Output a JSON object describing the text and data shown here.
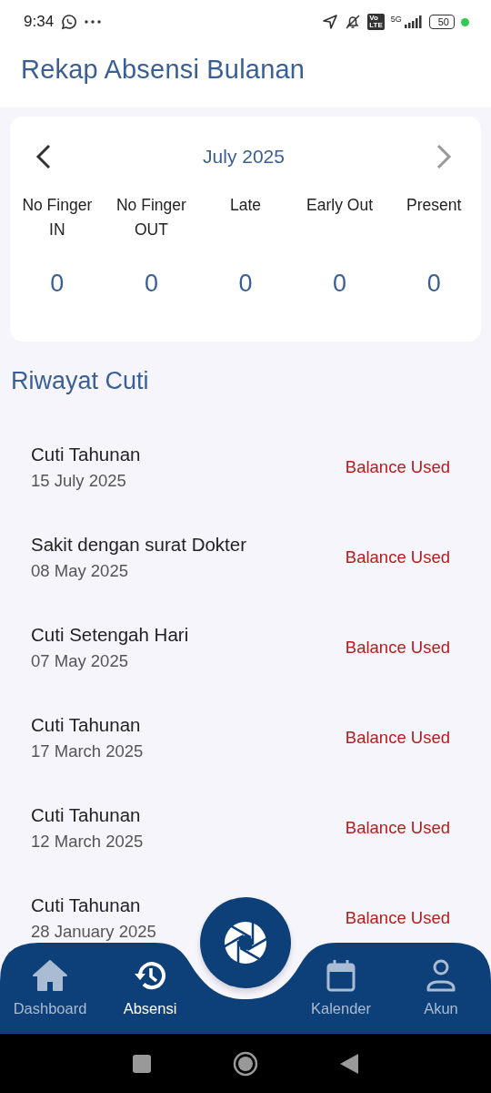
{
  "status_bar": {
    "time": "9:34",
    "volte": [
      "Vo",
      "LTE"
    ],
    "network": "5G",
    "battery": "50"
  },
  "header": {
    "title": "Rekap Absensi Bulanan"
  },
  "summary": {
    "month": "July 2025",
    "prev": {
      "disabled": false
    },
    "next": {
      "disabled": true
    },
    "columns": [
      {
        "label": "No Finger IN",
        "value": "0"
      },
      {
        "label": "No Finger OUT",
        "value": "0"
      },
      {
        "label": "Late",
        "value": "0"
      },
      {
        "label": "Early Out",
        "value": "0"
      },
      {
        "label": "Present",
        "value": "0"
      }
    ]
  },
  "leave_history": {
    "title": "Riwayat Cuti",
    "items": [
      {
        "type": "Cuti Tahunan",
        "date": "15 July 2025",
        "status": "Balance Used"
      },
      {
        "type": "Sakit dengan surat Dokter",
        "date": "08 May 2025",
        "status": "Balance Used"
      },
      {
        "type": "Cuti Setengah Hari",
        "date": "07 May 2025",
        "status": "Balance Used"
      },
      {
        "type": "Cuti Tahunan",
        "date": "17 March 2025",
        "status": "Balance Used"
      },
      {
        "type": "Cuti Tahunan",
        "date": "12 March 2025",
        "status": "Balance Used"
      },
      {
        "type": "Cuti Tahunan",
        "date": "28 January 2025",
        "status": "Balance Used"
      }
    ]
  },
  "bottom_nav": {
    "items": [
      {
        "kind": "home",
        "label": "Dashboard",
        "selected": false
      },
      {
        "kind": "history",
        "label": "Absensi",
        "selected": true
      },
      {
        "kind": "calendar",
        "label": "Kalender",
        "selected": false
      },
      {
        "kind": "person",
        "label": "Akun",
        "selected": false
      }
    ]
  }
}
